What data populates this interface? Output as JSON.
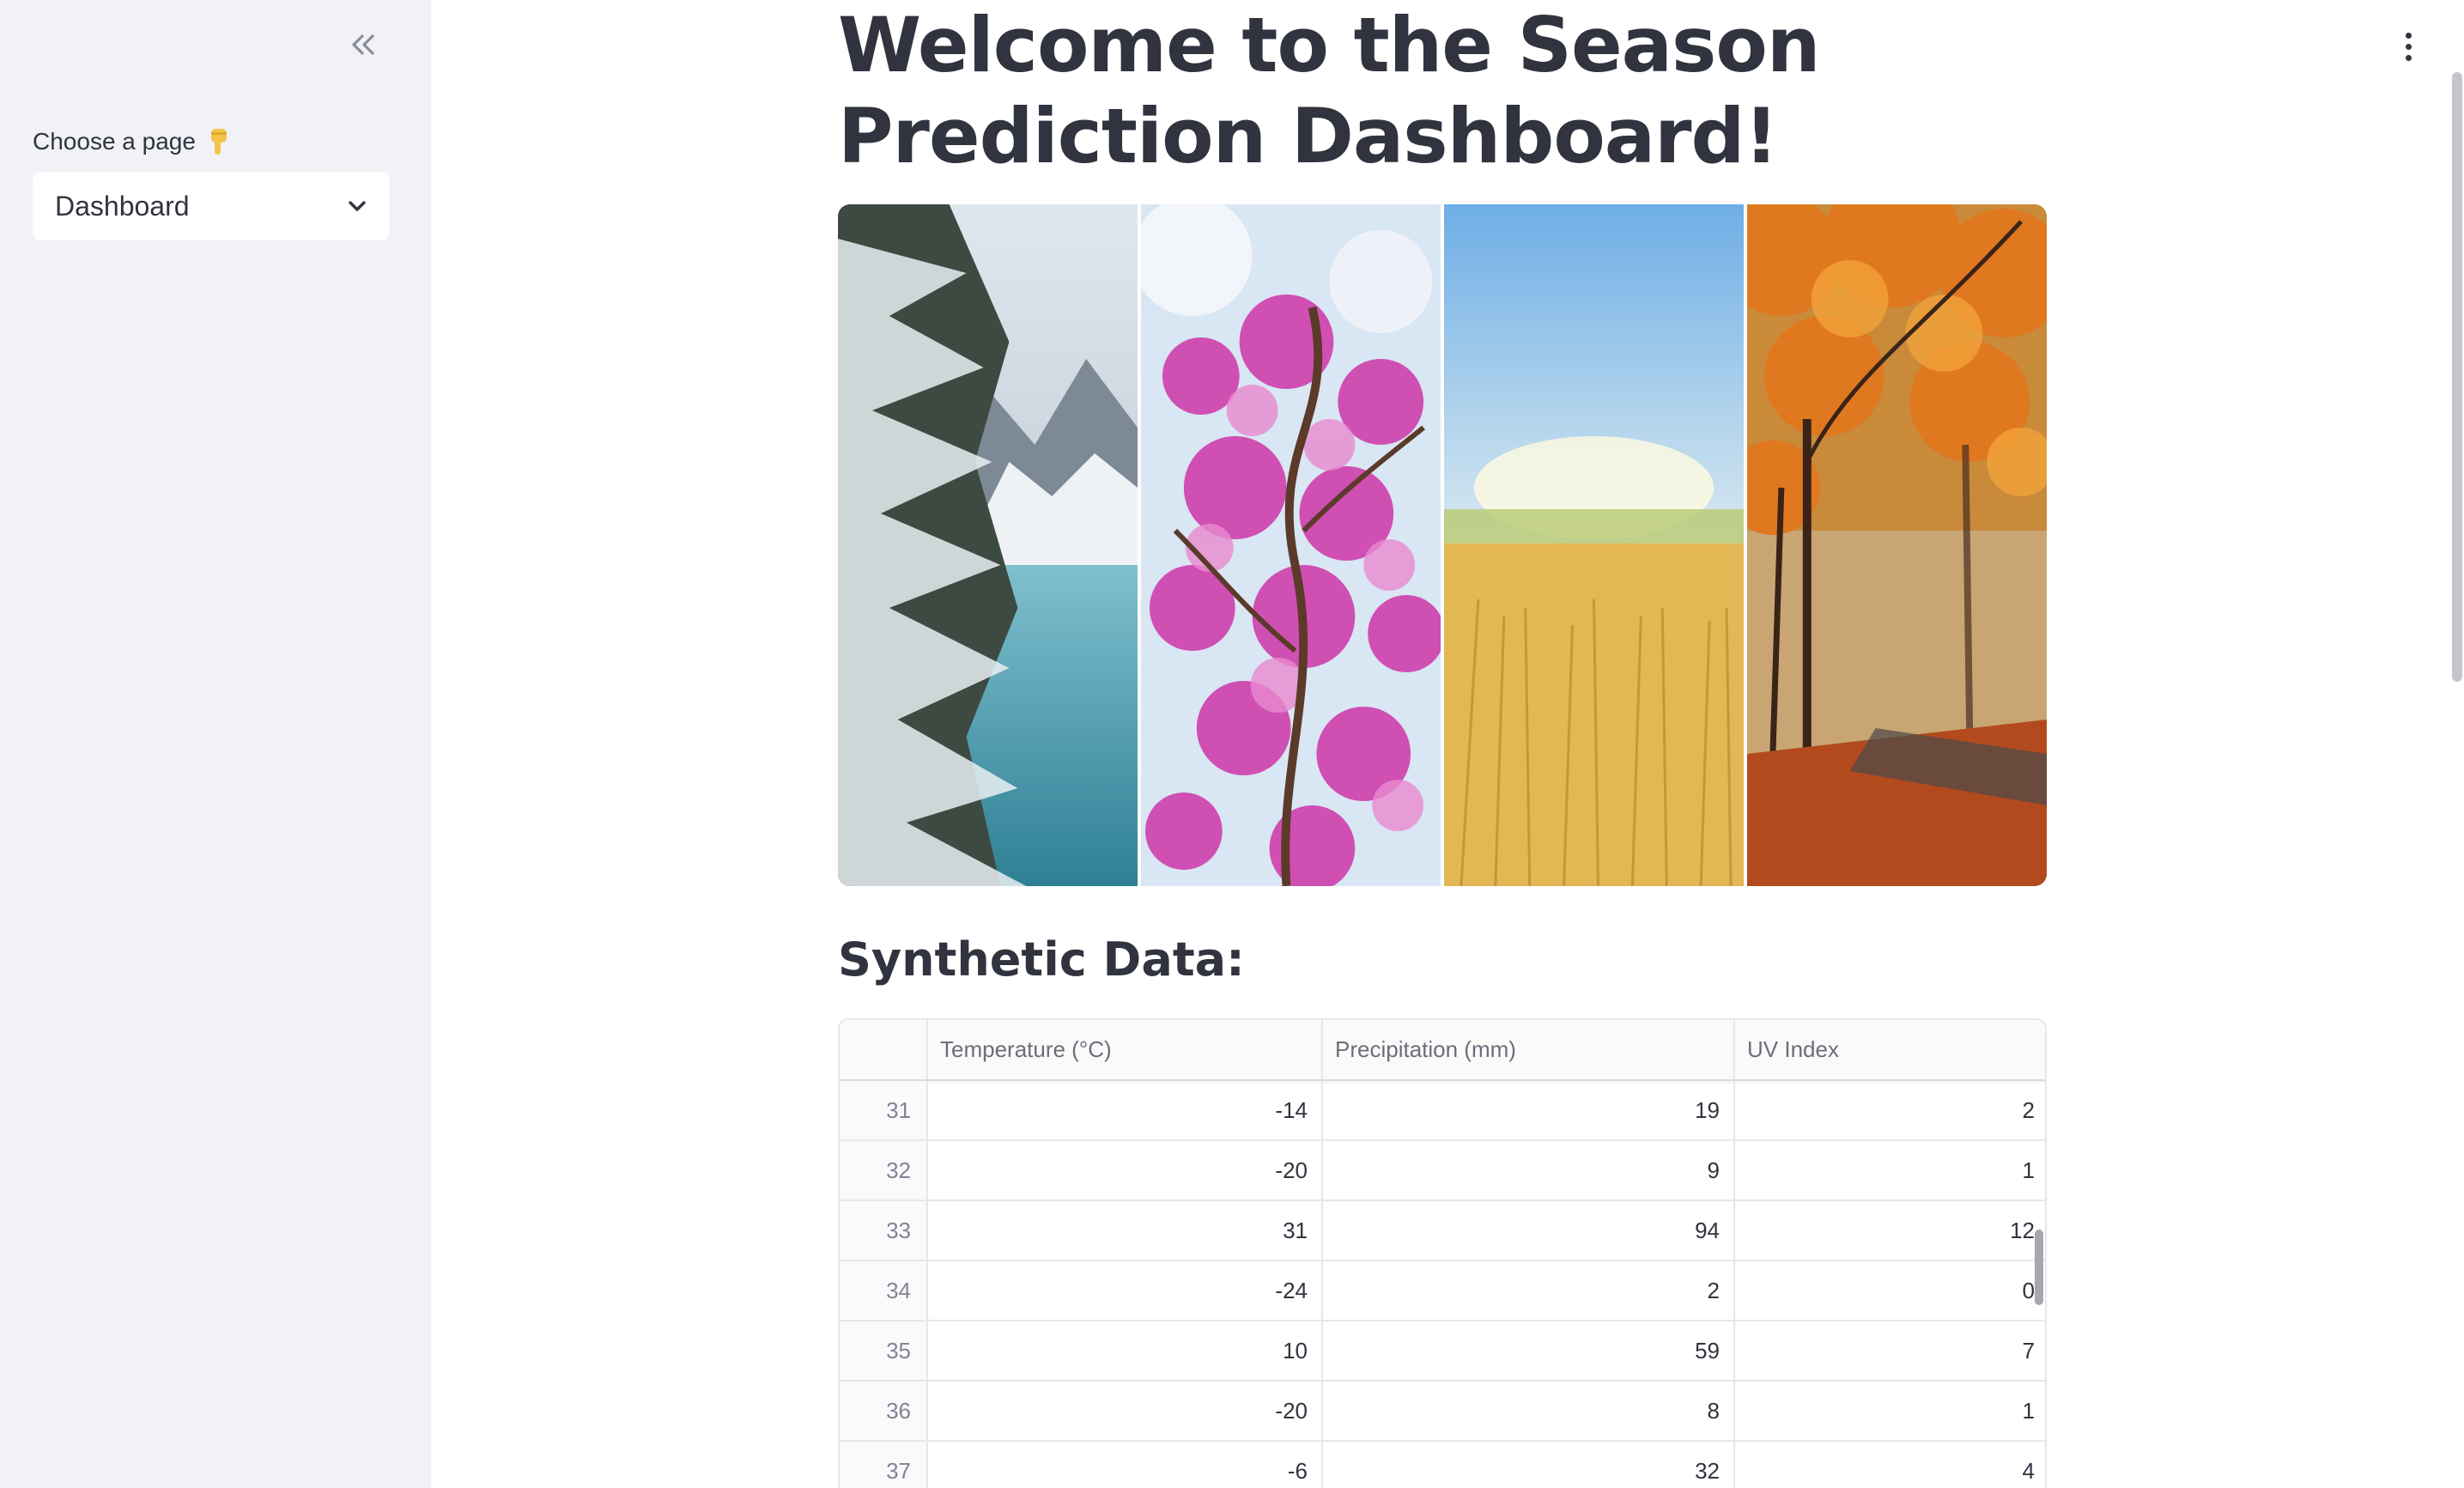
{
  "sidebar": {
    "label": "Choose a page",
    "label_icon": "pointing-down-hand-icon",
    "collapse_icon": "double-chevron-left-icon",
    "select": {
      "value": "Dashboard",
      "icon": "chevron-down-icon"
    }
  },
  "header": {
    "menu_icon": "vertical-ellipsis-icon"
  },
  "main": {
    "title": "Welcome to the Season Prediction Dashboard!",
    "hero_image": {
      "panels": [
        "winter",
        "spring",
        "summer",
        "autumn"
      ]
    },
    "section_heading": "Synthetic Data:",
    "table": {
      "columns": [
        "",
        "Temperature (°C)",
        "Precipitation (mm)",
        "UV Index"
      ],
      "rows": [
        [
          "31",
          "-14",
          "19",
          "2"
        ],
        [
          "32",
          "-20",
          "9",
          "1"
        ],
        [
          "33",
          "31",
          "94",
          "12"
        ],
        [
          "34",
          "-24",
          "2",
          "0"
        ],
        [
          "35",
          "10",
          "59",
          "7"
        ],
        [
          "36",
          "-20",
          "8",
          "1"
        ],
        [
          "37",
          "-6",
          "32",
          "4"
        ]
      ]
    }
  },
  "colors": {
    "sidebar_bg": "#f0f2f6",
    "text": "#31333f",
    "muted_text": "#808495",
    "border": "#e6e7eb"
  }
}
